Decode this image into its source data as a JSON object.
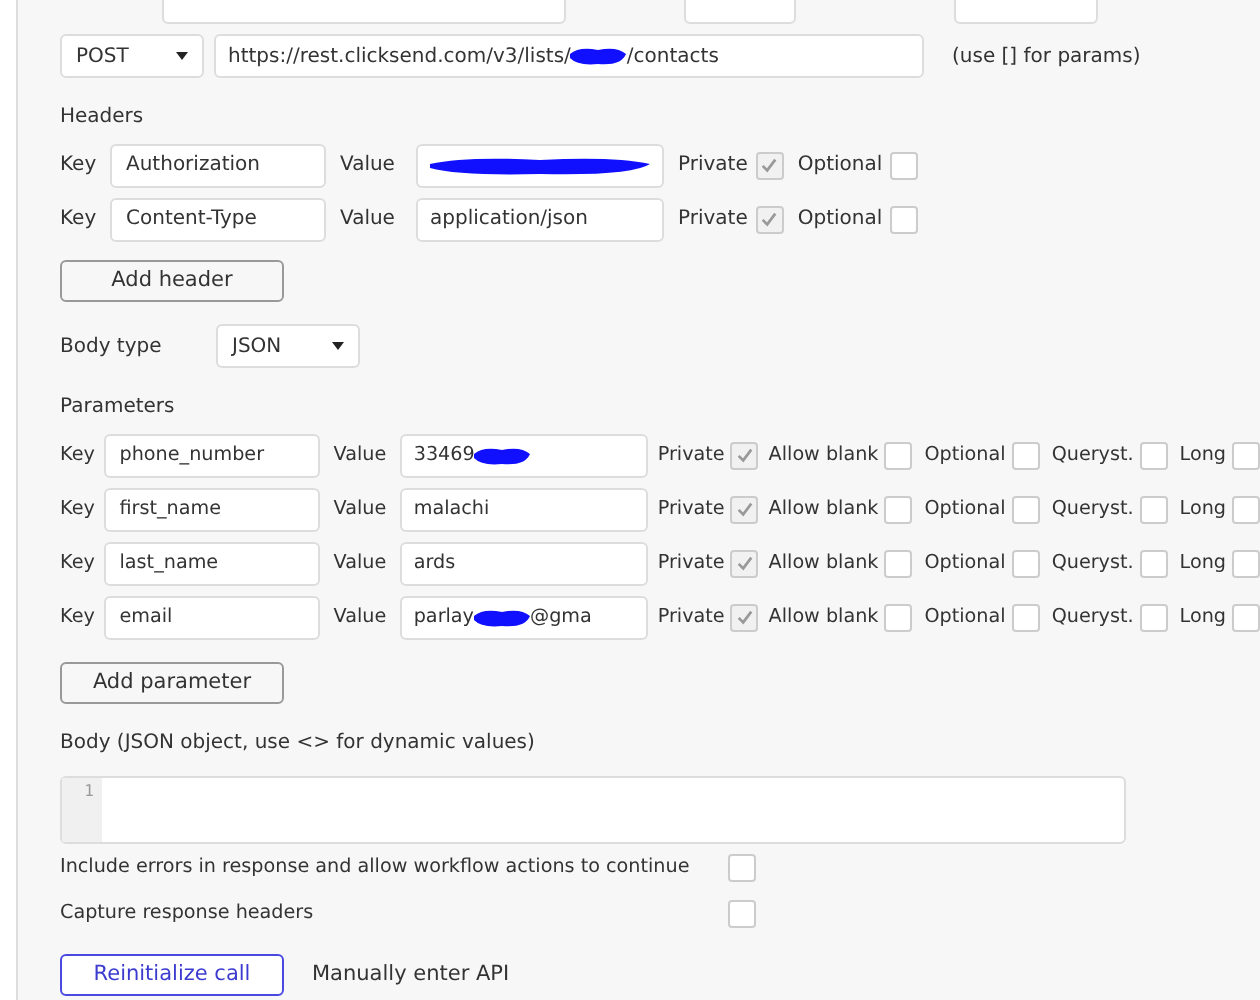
{
  "request": {
    "method": "POST",
    "url": [
      {
        "kind": "text",
        "text": "https://rest.clicksend.com/v3/lists/"
      },
      {
        "kind": "redacted"
      },
      {
        "kind": "text",
        "text": "/contacts"
      }
    ],
    "hint": "(use [] for params)"
  },
  "headers": {
    "title": "Headers",
    "rows": [
      {
        "key_label": "Key",
        "key": "Authorization",
        "value_label": "Value",
        "value": [
          {
            "kind": "redacted"
          }
        ],
        "private_label": "Private",
        "private": true,
        "optional_label": "Optional",
        "optional": false
      },
      {
        "key_label": "Key",
        "key": "Content-Type",
        "value_label": "Value",
        "value": [
          {
            "kind": "text",
            "text": "application/json"
          }
        ],
        "private_label": "Private",
        "private": true,
        "optional_label": "Optional",
        "optional": false
      }
    ],
    "add_button": "Add header"
  },
  "body_type": {
    "label": "Body type",
    "value": "JSON"
  },
  "parameters": {
    "title": "Parameters",
    "rows": [
      {
        "key_label": "Key",
        "key": "phone_number",
        "value_label": "Value",
        "value": [
          {
            "kind": "text",
            "text": "33469"
          },
          {
            "kind": "redacted"
          }
        ],
        "private_label": "Private",
        "private": true,
        "allow_blank_label": "Allow blank",
        "allow_blank": false,
        "optional_label": "Optional",
        "optional": false,
        "querystring_label": "Queryst.",
        "querystring": false,
        "long_label": "Long",
        "long": false
      },
      {
        "key_label": "Key",
        "key": "first_name",
        "value_label": "Value",
        "value": [
          {
            "kind": "text",
            "text": "malachi"
          }
        ],
        "private_label": "Private",
        "private": true,
        "allow_blank_label": "Allow blank",
        "allow_blank": false,
        "optional_label": "Optional",
        "optional": false,
        "querystring_label": "Queryst.",
        "querystring": false,
        "long_label": "Long",
        "long": false
      },
      {
        "key_label": "Key",
        "key": "last_name",
        "value_label": "Value",
        "value": [
          {
            "kind": "text",
            "text": "ards"
          }
        ],
        "private_label": "Private",
        "private": true,
        "allow_blank_label": "Allow blank",
        "allow_blank": false,
        "optional_label": "Optional",
        "optional": false,
        "querystring_label": "Queryst.",
        "querystring": false,
        "long_label": "Long",
        "long": false
      },
      {
        "key_label": "Key",
        "key": "email",
        "value_label": "Value",
        "value": [
          {
            "kind": "text",
            "text": "parlay"
          },
          {
            "kind": "redacted"
          },
          {
            "kind": "text",
            "text": "@gma"
          }
        ],
        "private_label": "Private",
        "private": true,
        "allow_blank_label": "Allow blank",
        "allow_blank": false,
        "optional_label": "Optional",
        "optional": false,
        "querystring_label": "Queryst.",
        "querystring": false,
        "long_label": "Long",
        "long": false
      }
    ],
    "add_button": "Add parameter"
  },
  "body": {
    "label": "Body (JSON object, use <> for dynamic values)",
    "line_numbers": [
      "1"
    ]
  },
  "options": [
    {
      "label": "Include errors in response and allow workflow actions to continue",
      "checked": false
    },
    {
      "label": "Capture response headers",
      "checked": false
    }
  ],
  "actions": {
    "reinitialize": "Reinitialize call",
    "manual": "Manually enter API"
  }
}
